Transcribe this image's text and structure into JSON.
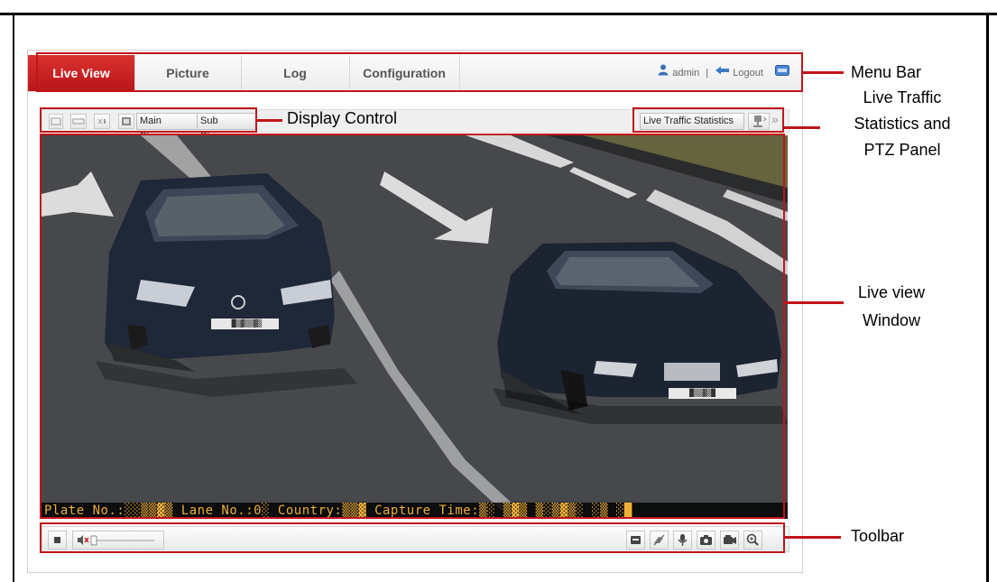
{
  "menu": {
    "tabs": [
      {
        "label": "Live View"
      },
      {
        "label": "Picture"
      },
      {
        "label": "Log"
      },
      {
        "label": "Configuration"
      }
    ],
    "user": "admin",
    "separator": "|",
    "logout": "Logout"
  },
  "display_control": {
    "main_stream": "Main Stream",
    "sub_stream": "Sub Stream",
    "live_traffic_statistics": "Live Traffic Statistics",
    "ptz_expand": "»"
  },
  "live_view": {
    "osd_text": "Plate No.:░░▒▒▓▒ Lane No.:0░ Country:▒▒▓ Capture Time:▒░ ▒▓▒ ▒░▒▓▒░ ░▒ ░█",
    "plate_left": "█▒▓▒▒▓▒",
    "plate_right": "█▒▒▓▒█"
  },
  "toolbar": {
    "volume_level": 0
  },
  "callouts": {
    "menu_bar": "Menu Bar",
    "display_control": "Display Control",
    "traffic_line1": "Live Traffic",
    "traffic_line2": "Statistics and",
    "traffic_line3": "PTZ Panel",
    "live_view_line1": "Live view",
    "live_view_line2": "Window",
    "toolbar": "Toolbar"
  },
  "colors": {
    "accent_red": "#c0141a",
    "active_tab": "#c8221f",
    "road": "#46484b",
    "osd": "#f0b038"
  }
}
